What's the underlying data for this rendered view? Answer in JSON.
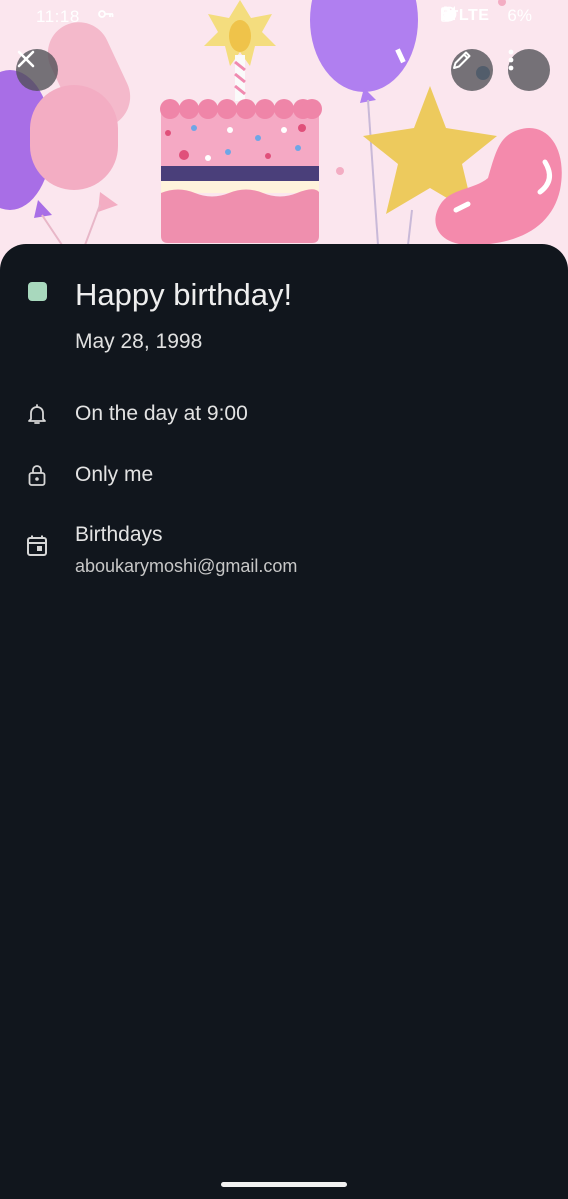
{
  "status_bar": {
    "time": "11:18",
    "network": "LTE",
    "battery": "6%"
  },
  "header": {
    "background_color": "#fbe6ee",
    "illustration": "birthday-cake-with-balloons"
  },
  "actions": {
    "close_icon": "close-icon",
    "edit_icon": "pencil-icon",
    "more_icon": "more-vert-icon"
  },
  "event": {
    "color": "#a8d8bd",
    "title": "Happy birthday!",
    "date": "May 28, 1998",
    "reminder": "On the day at 9:00",
    "visibility": "Only me",
    "calendar_name": "Birthdays",
    "calendar_account": "aboukarymoshi@gmail.com"
  }
}
